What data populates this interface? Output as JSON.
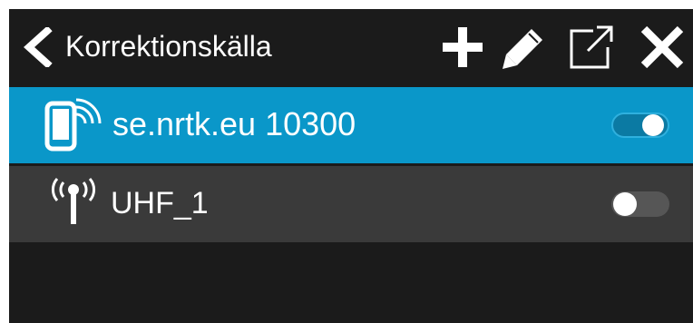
{
  "header": {
    "title": "Korrektionskälla",
    "icons": {
      "back": "chevron-left-icon",
      "add": "plus-icon",
      "edit": "pencil-icon",
      "open": "open-external-icon",
      "close": "close-icon"
    }
  },
  "sources": [
    {
      "label": "se.nrtk.eu 10300",
      "icon": "mobile-signal-icon",
      "enabled": true,
      "selected": true
    },
    {
      "label": "UHF_1",
      "icon": "radio-antenna-icon",
      "enabled": false,
      "selected": false
    }
  ],
  "colors": {
    "background": "#1b1b1b",
    "selected_row": "#0a97c9",
    "row": "#3a3a3a",
    "text": "#ffffff"
  }
}
